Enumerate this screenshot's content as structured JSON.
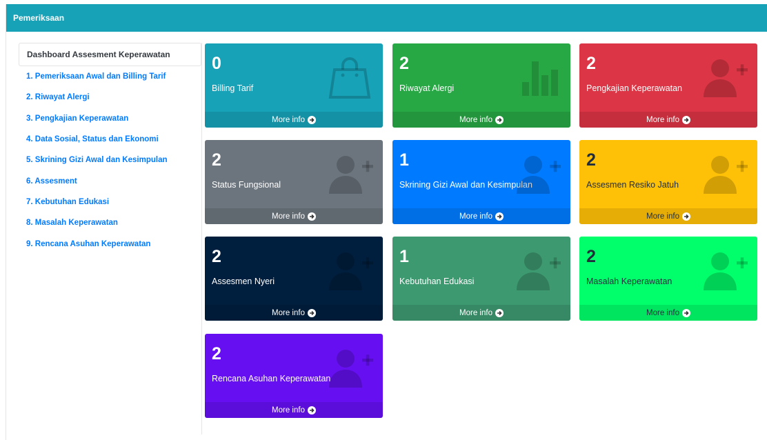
{
  "header": {
    "title": "Pemeriksaan"
  },
  "sidebar": {
    "heading": "Dashboard Assesment Keperawatan",
    "items": [
      {
        "label": "1. Pemeriksaan Awal dan Billing Tarif"
      },
      {
        "label": "2. Riwayat Alergi"
      },
      {
        "label": "3. Pengkajian Keperawatan"
      },
      {
        "label": "4. Data Sosial, Status dan Ekonomi"
      },
      {
        "label": "5. Skrining Gizi Awal dan Kesimpulan"
      },
      {
        "label": "6. Assesment"
      },
      {
        "label": "7. Kebutuhan Edukasi"
      },
      {
        "label": "8. Masalah Keperawatan"
      },
      {
        "label": "9. Rencana Asuhan Keperawatan"
      }
    ]
  },
  "cards": [
    {
      "count": "0",
      "label": "Billing Tarif",
      "more": "More info",
      "color": "#17a2b8",
      "icon": "shopping-bag-icon"
    },
    {
      "count": "2",
      "label": "Riwayat Alergi",
      "more": "More info",
      "color": "#28a745",
      "icon": "bar-chart-icon"
    },
    {
      "count": "2",
      "label": "Pengkajian Keperawatan",
      "more": "More info",
      "color": "#dc3545",
      "icon": "user-plus-icon"
    },
    {
      "count": "2",
      "label": "Status Fungsional",
      "more": "More info",
      "color": "#6c757d",
      "icon": "user-plus-icon"
    },
    {
      "count": "1",
      "label": "Skrining Gizi Awal dan Kesimpulan",
      "more": "More info",
      "color": "#007bff",
      "icon": "user-plus-icon"
    },
    {
      "count": "2",
      "label": "Assesmen Resiko Jatuh",
      "more": "More info",
      "color": "#ffc107",
      "icon": "user-plus-icon",
      "text_color": "#1f2d3d"
    },
    {
      "count": "2",
      "label": "Assesmen Nyeri",
      "more": "More info",
      "color": "#001f3f",
      "icon": "user-plus-icon"
    },
    {
      "count": "1",
      "label": "Kebutuhan Edukasi",
      "more": "More info",
      "color": "#3d9970",
      "icon": "user-plus-icon"
    },
    {
      "count": "2",
      "label": "Masalah Keperawatan",
      "more": "More info",
      "color": "#00ff6a",
      "icon": "user-plus-icon",
      "text_color": "#1f2d3d"
    },
    {
      "count": "2",
      "label": "Rencana Asuhan Keperawatan",
      "more": "More info",
      "color": "#6610f2",
      "icon": "user-plus-icon"
    }
  ]
}
